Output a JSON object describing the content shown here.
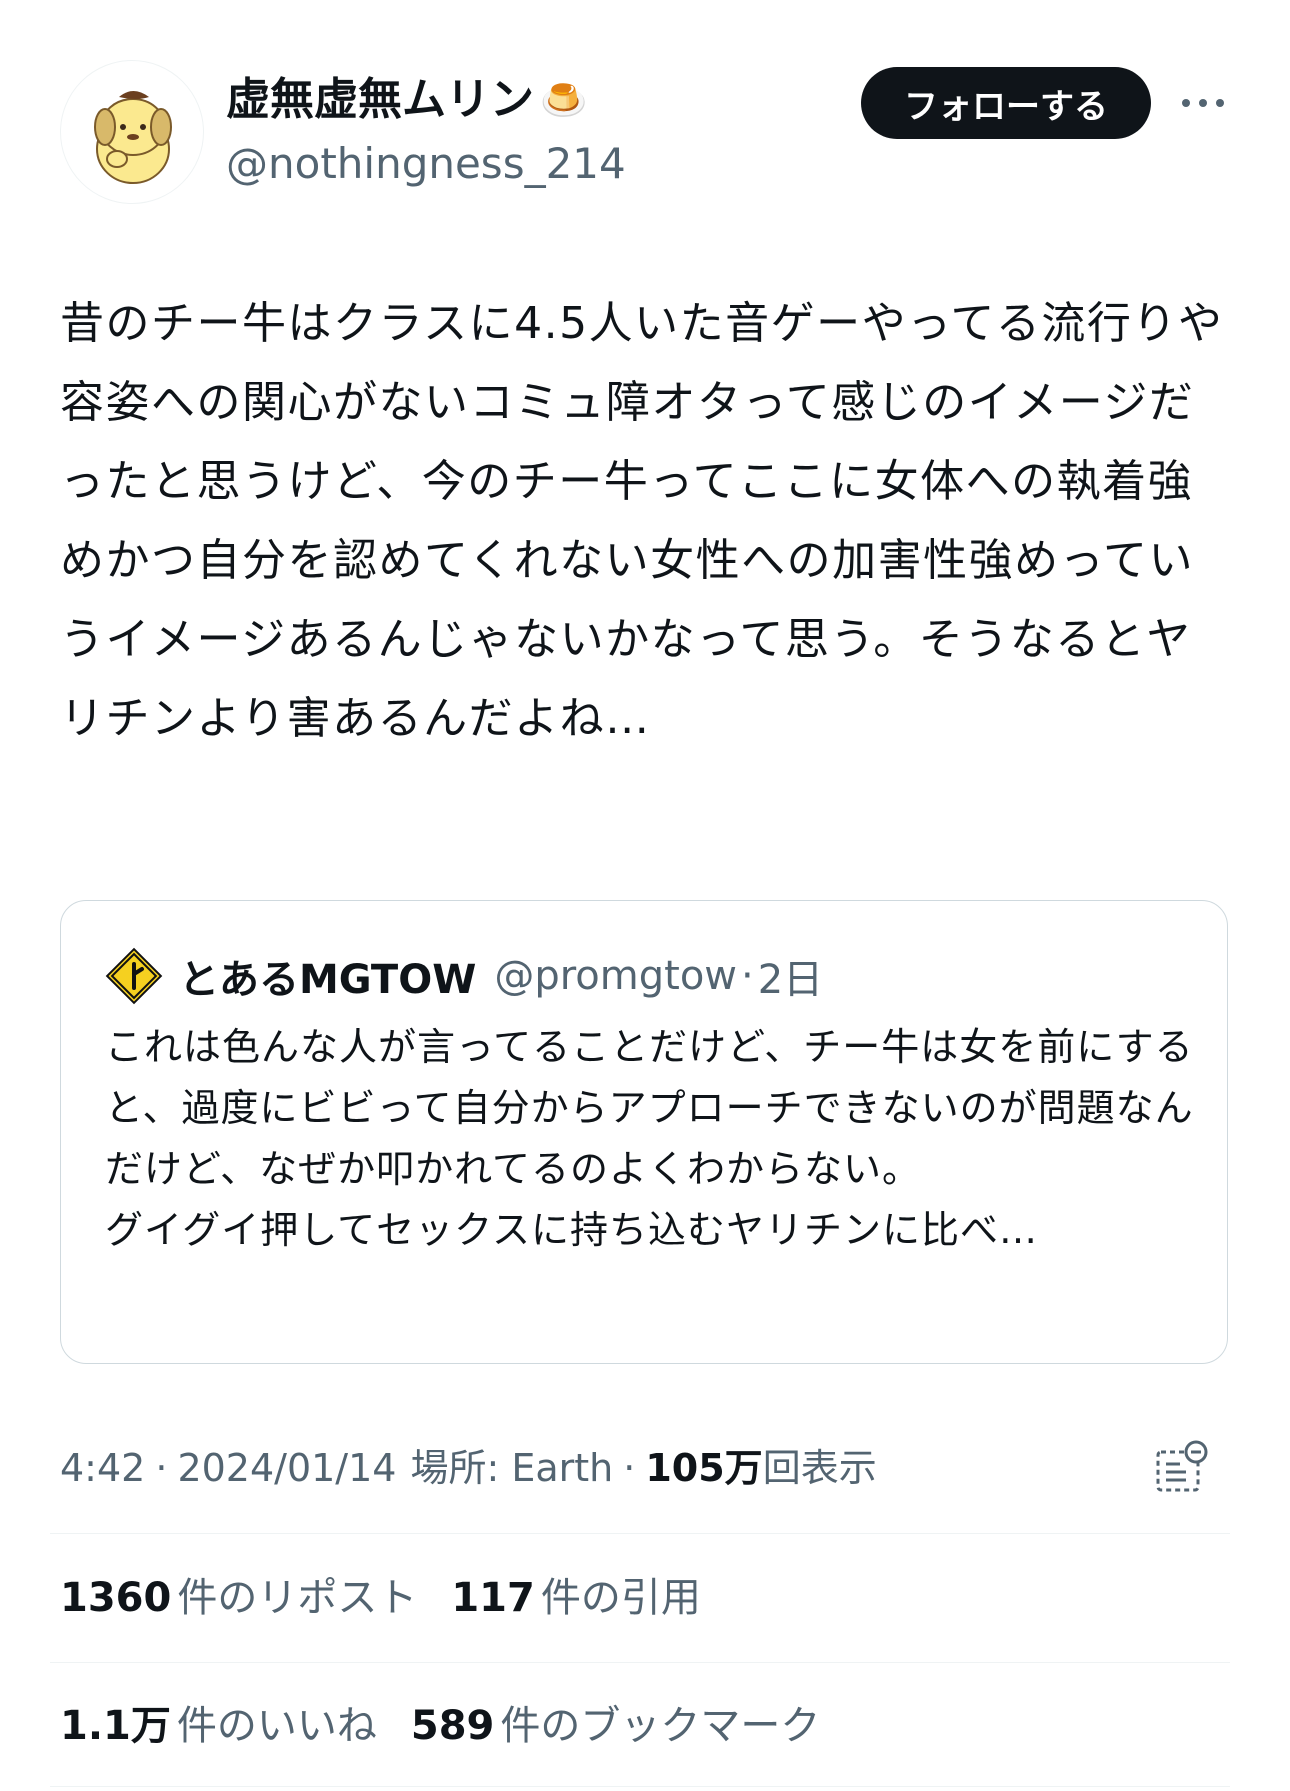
{
  "author": {
    "display_name": "虚無虚無ムリン",
    "name_emoji": "🍮",
    "handle": "@nothingness_214",
    "follow_label": "フォローする"
  },
  "tweet": {
    "text": "昔のチー牛はクラスに4.5人いた音ゲーやってる流行りや容姿への関心がないコミュ障オタって感じのイメージだったと思うけど、今のチー牛ってここに女体への執着強めかつ自分を認めてくれない女性への加害性強めっていうイメージあるんじゃないかなって思う。そうなるとヤリチンより害あるんだよね…"
  },
  "quote": {
    "display_name": "とあるMGTOW",
    "handle": "@promgtow",
    "separator": "·",
    "time": "2日",
    "text": "これは色んな人が言ってることだけど、チー牛は女を前にすると、過度にビビって自分からアプローチできないのが問題なんだけど、なぜか叩かれてるのよくわからない。\nグイグイ押してセックスに持ち込むヤリチンに比べ…"
  },
  "meta": {
    "time": "4:42",
    "sep1": "·",
    "date": "2024/01/14",
    "location_label": "場所: Earth",
    "sep2": "·",
    "views_count": "105万",
    "views_label": "回表示"
  },
  "stats": {
    "reposts_count": "1360",
    "reposts_label": "件のリポスト",
    "quotes_count": "117",
    "quotes_label": "件の引用",
    "likes_count": "1.1万",
    "likes_label": "件のいいね",
    "bookmarks_count": "589",
    "bookmarks_label": "件のブックマーク"
  },
  "colors": {
    "text": "#0f1419",
    "secondary": "#536471",
    "border": "#cfd9de",
    "divider": "#eff3f4",
    "follow_bg": "#0f1419",
    "sign_yellow": "#f5d020"
  },
  "icons": {
    "avatar": "pompompurin-avatar",
    "more": "more-dots-icon",
    "quote_avatar": "road-sign-icon",
    "analytics": "analytics-icon"
  }
}
